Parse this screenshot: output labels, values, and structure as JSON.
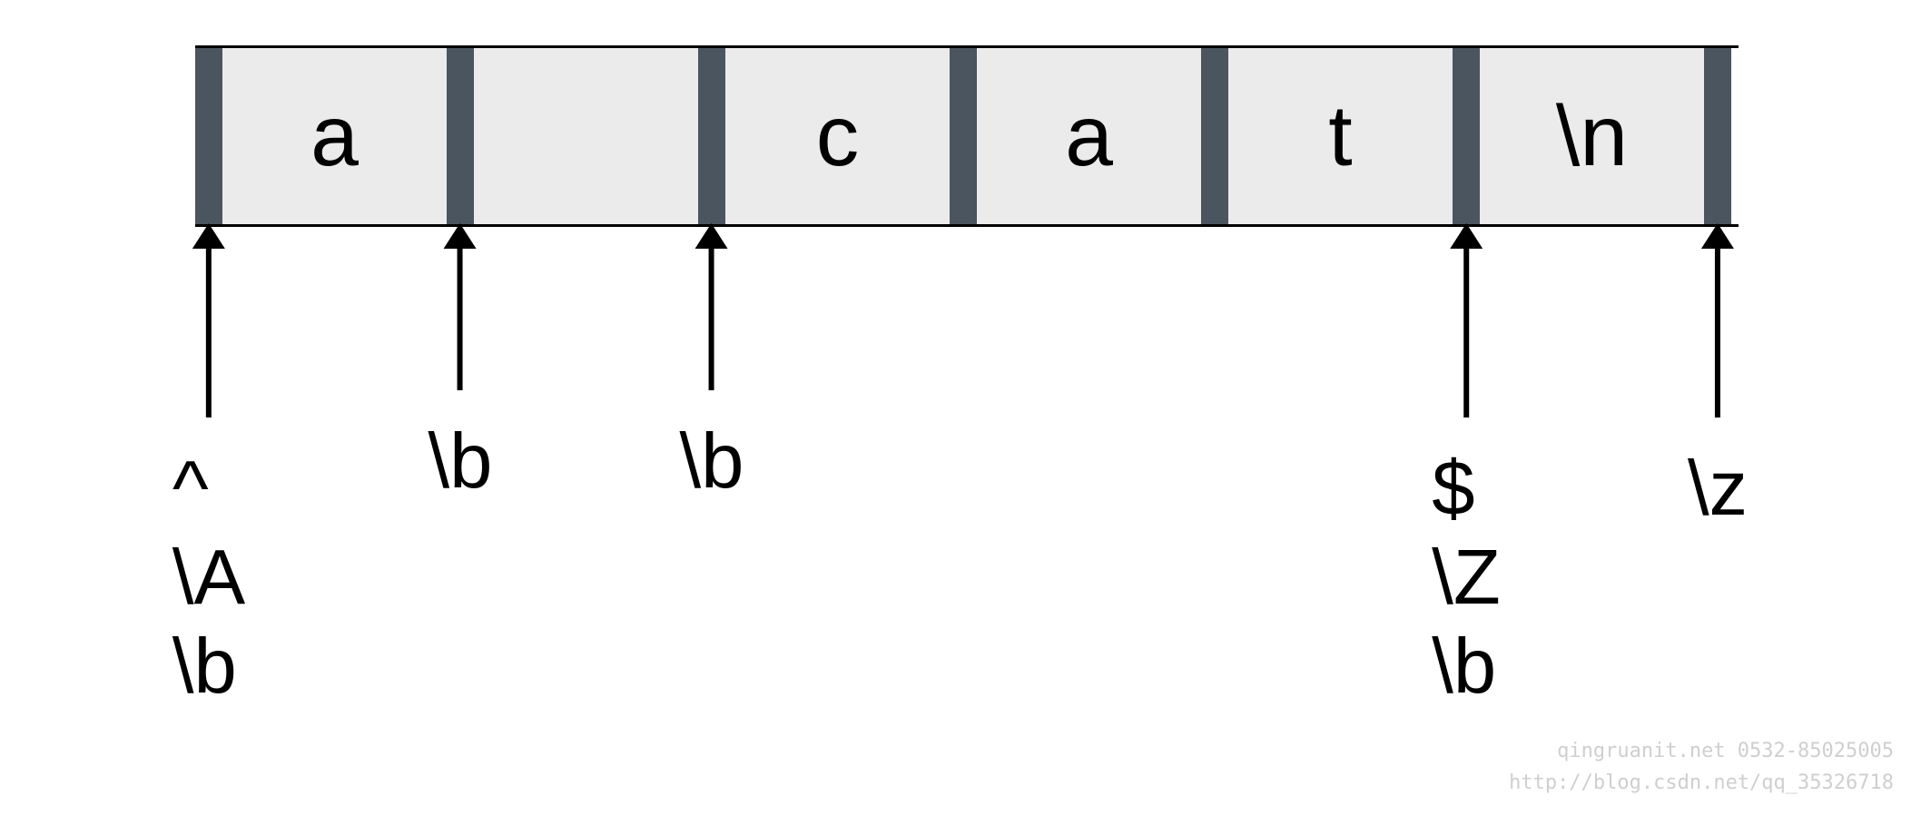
{
  "cells": {
    "c0": "a",
    "c1": "",
    "c2": "c",
    "c3": "a",
    "c4": "t",
    "c5": "\\n"
  },
  "anchors": {
    "p0": {
      "lines": [
        "^",
        "\\A",
        "\\b"
      ]
    },
    "p1": {
      "lines": [
        "\\b"
      ]
    },
    "p2": {
      "lines": [
        "\\b"
      ]
    },
    "p5": {
      "lines": [
        "$",
        "\\Z",
        "\\b"
      ]
    },
    "p6": {
      "lines": [
        "\\z"
      ]
    }
  },
  "watermark": {
    "line1": "qingruanit.net 0532-85025005",
    "line2": "http://blog.csdn.net/qq_35326718"
  }
}
